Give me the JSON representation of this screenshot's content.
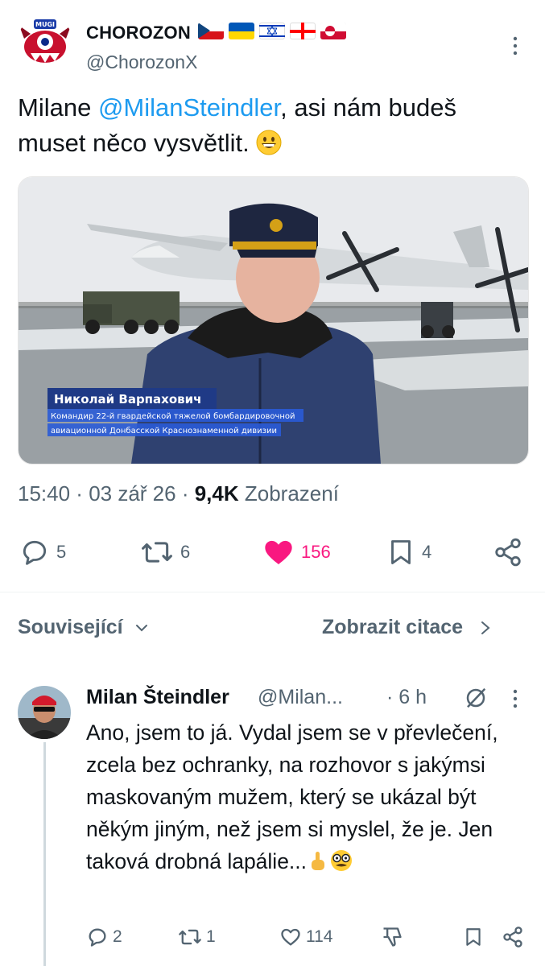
{
  "tweet": {
    "display_name": "CHOROZON",
    "flags": [
      "cz-flag-icon",
      "ua-flag-icon",
      "il-flag-icon",
      "ge-flag-icon",
      "gl-flag-icon"
    ],
    "avatar_text": "MUGI",
    "handle": "@ChorozonX",
    "text_before": "Milane ",
    "mention": "@MilanSteindler",
    "text_after": ", asi nám budeš muset něco vysvětlit. ",
    "media": {
      "caption_name": "Николай Варпахович",
      "caption_line1": "Командир 22-й гвардейской тяжелой бомбардировочной",
      "caption_line2": "авиационной Донбасской Краснознаменной дивизии"
    },
    "time": "15:40",
    "date": "03 zář 26",
    "views_count": "9,4K",
    "views_label": "Zobrazení",
    "replies": "5",
    "retweets": "6",
    "likes": "156",
    "bookmarks": "4"
  },
  "related": {
    "label": "Související",
    "quotes_label": "Zobrazit citace"
  },
  "reply": {
    "name": "Milan Šteindler",
    "handle": "@Milan...",
    "time": "· 6 h",
    "text": "Ano, jsem to já. Vydal jsem se v převlečení, zcela bez ochranky, na rozhovor s jakýmsi maskovaným mužem, který se ukázal být někým jiným, než jsem si myslel, že je. Jen taková drobná lapálie...",
    "replies": "2",
    "retweets": "1",
    "likes": "114"
  },
  "colors": {
    "accent": "#1d9bf0",
    "like": "#f91880",
    "muted": "#536471"
  }
}
